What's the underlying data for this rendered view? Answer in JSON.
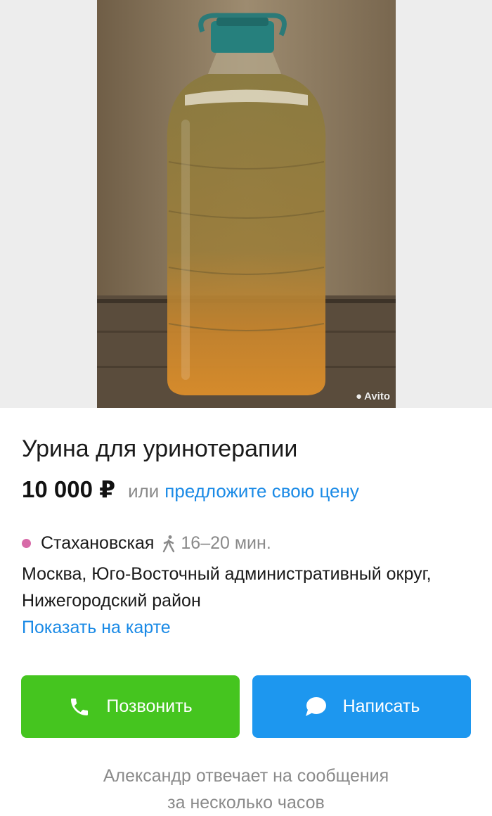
{
  "listing": {
    "photo": {
      "alt": "bottle-photo",
      "watermark": "Avito"
    },
    "title": "Урина для уринотерапии",
    "price": "10 000 ₽",
    "price_or": "или",
    "price_offer_link": "предложите свою цену",
    "location": {
      "metro_station": "Стахановская",
      "metro_color": "#d76aa8",
      "walk_time": "16–20 мин.",
      "address": "Москва, Юго-Восточный административный округ, Нижегородский район",
      "map_link": "Показать на карте"
    }
  },
  "actions": {
    "call_label": "Позвонить",
    "call_icon": "phone-icon",
    "call_color": "#45c51f",
    "message_label": "Написать",
    "message_icon": "chat-bubble-icon",
    "message_color": "#1d97ef"
  },
  "seller": {
    "reply_note_line1": "Александр отвечает на сообщения",
    "reply_note_line2": "за несколько часов"
  }
}
